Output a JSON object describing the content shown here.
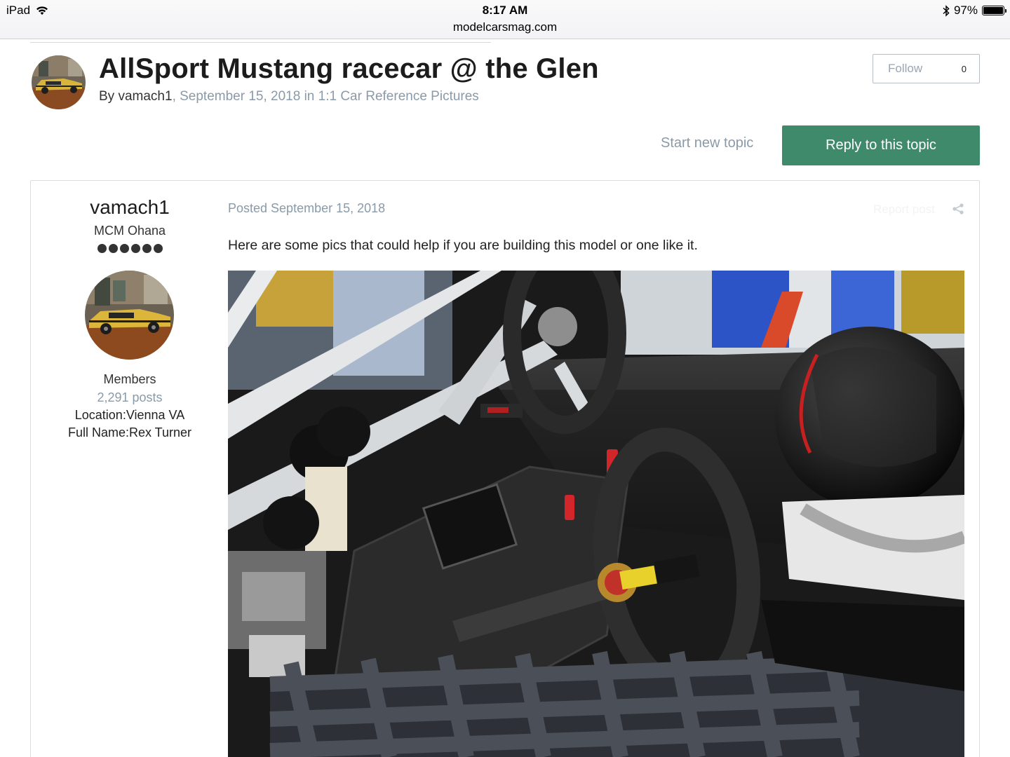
{
  "status_bar": {
    "device": "iPad",
    "time": "8:17 AM",
    "url": "modelcarsmag.com",
    "battery": "97%",
    "icons": [
      "wifi-icon",
      "bluetooth-icon",
      "battery-icon"
    ]
  },
  "topic": {
    "title": "AllSport Mustang racecar @ the Glen",
    "by_prefix": "By ",
    "author": "vamach1",
    "date_and_forum": ", September 15, 2018 in 1:1 Car Reference Pictures"
  },
  "follow": {
    "label": "Follow",
    "count": "0"
  },
  "actions": {
    "start_new_topic": "Start new topic",
    "reply": "Reply to this topic"
  },
  "post": {
    "author": {
      "name": "vamach1",
      "rank": "MCM Ohana",
      "rank_pips": 6,
      "group": "Members",
      "posts": "2,291 posts",
      "location": "Location:Vienna VA",
      "full_name": "Full Name:Rex Turner"
    },
    "posted": "Posted September 15, 2018",
    "report": "Report post",
    "body": "Here are some pics that could help if you are building this model or one like it."
  },
  "colors": {
    "accent_green": "#3f8a6b",
    "muted_text": "#8a9aa8",
    "border": "#dcdcdc"
  }
}
